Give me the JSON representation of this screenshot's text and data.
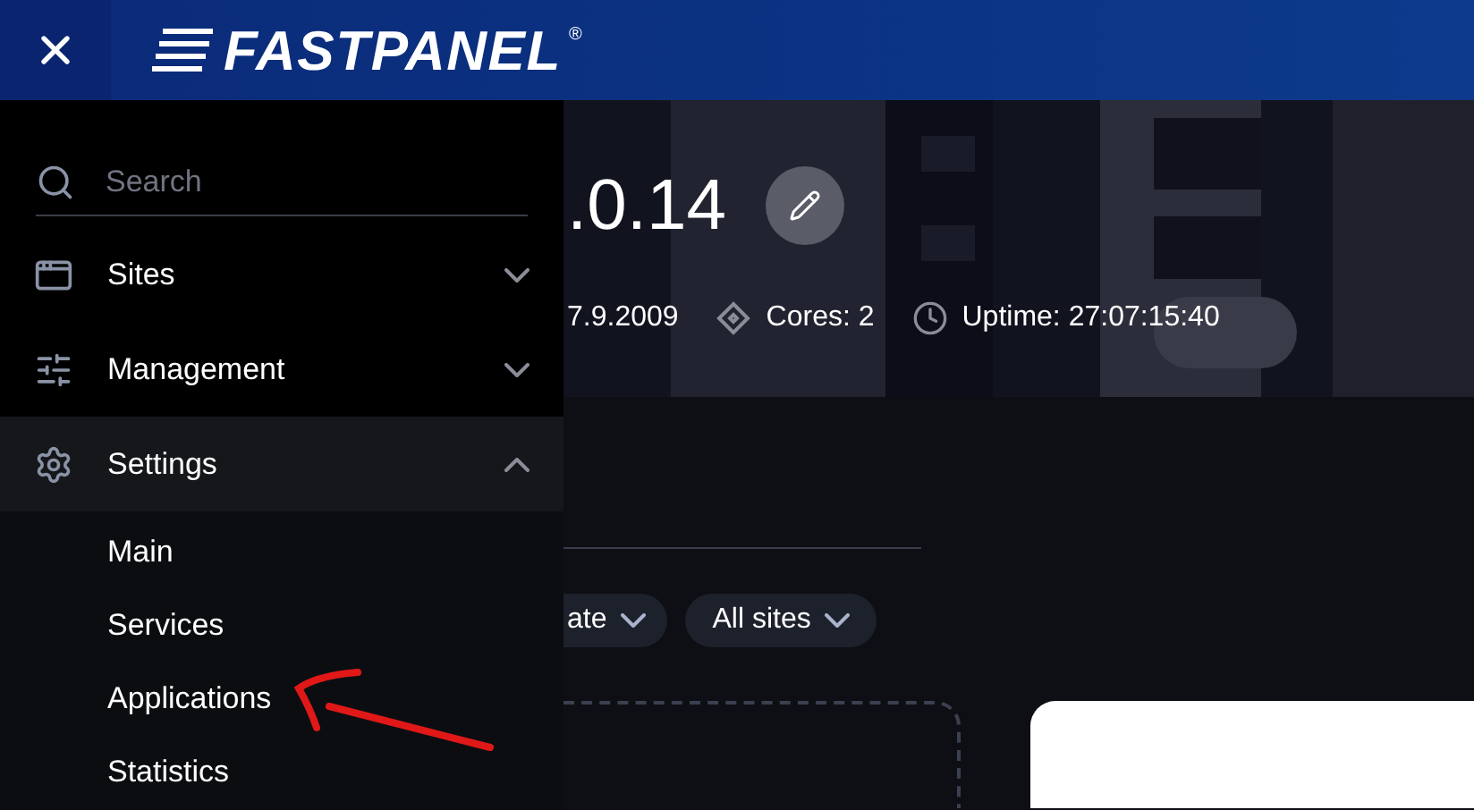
{
  "header": {
    "logo": "FASTPANEL",
    "registered": "®"
  },
  "sidebar": {
    "search": {
      "placeholder": "Search"
    },
    "items": [
      {
        "label": "Sites",
        "kind": "window",
        "expanded": false
      },
      {
        "label": "Management",
        "kind": "sliders",
        "expanded": false
      },
      {
        "label": "Settings",
        "kind": "gear",
        "expanded": true,
        "children": [
          {
            "label": "Main"
          },
          {
            "label": "Services"
          },
          {
            "label": "Applications"
          },
          {
            "label": "Statistics"
          }
        ]
      }
    ]
  },
  "server": {
    "title": ".0.14",
    "meta": [
      {
        "kind": "date",
        "text": "7.9.2009"
      },
      {
        "kind": "cores",
        "text": "Cores: 2"
      },
      {
        "kind": "uptime",
        "text": "Uptime: 27:07:15:40"
      }
    ]
  },
  "filters": [
    {
      "label": "ate"
    },
    {
      "label": "All sites"
    }
  ]
}
